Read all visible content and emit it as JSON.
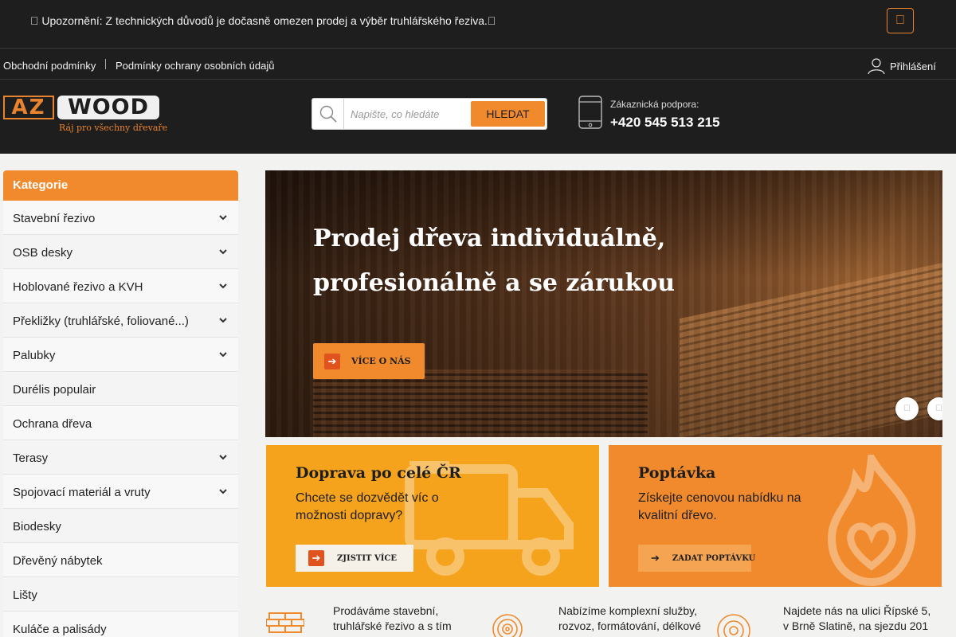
{
  "announcement": {
    "text": " Upozornění: Z technických důvodů je dočasně omezen prodej a výběr truhlářského řeziva.",
    "close_icon": ""
  },
  "top_links": {
    "terms": "Obchodní podmínky",
    "privacy": "Podmínky ochrany osobních údajů",
    "login": "Přihlášení"
  },
  "logo": {
    "az": "AZ",
    "wood": "WOOD",
    "tagline": "Ráj pro všechny dřevaře"
  },
  "search": {
    "placeholder": "Napište, co hledáte",
    "button": "HLEDAT"
  },
  "support": {
    "label": "Zákaznická podpora:",
    "phone": "+420 545 513 215"
  },
  "sidebar": {
    "title": "Kategorie",
    "items": [
      {
        "label": "Stavební řezivo",
        "has_sub": true
      },
      {
        "label": "OSB desky",
        "has_sub": true
      },
      {
        "label": "Hoblované řezivo a KVH",
        "has_sub": true
      },
      {
        "label": "Překližky (truhlářské, foliované...)",
        "has_sub": true
      },
      {
        "label": "Palubky",
        "has_sub": true
      },
      {
        "label": "Durélis populair",
        "has_sub": false
      },
      {
        "label": "Ochrana dřeva",
        "has_sub": false
      },
      {
        "label": "Terasy",
        "has_sub": true
      },
      {
        "label": "Spojovací materiál a vruty",
        "has_sub": true
      },
      {
        "label": "Biodesky",
        "has_sub": false
      },
      {
        "label": "Dřevěný nábytek",
        "has_sub": false
      },
      {
        "label": "Lišty",
        "has_sub": false
      },
      {
        "label": "Kuláče a palisády",
        "has_sub": false
      }
    ]
  },
  "hero": {
    "title_line1": "Prodej dřeva individuálně,",
    "title_line2": "profesionálně a se zárukou",
    "button": "VÍCE O NÁS",
    "prev_icon": "",
    "next_icon": ""
  },
  "promos": {
    "delivery": {
      "title": "Doprava po celé ČR",
      "desc": "Chcete se dozvědět víc o možnosti dopravy?",
      "button": "ZJISTIT VÍCE"
    },
    "inquiry": {
      "title": "Poptávka",
      "desc": "Získejte cenovou nabídku na kvalitní dřevo.",
      "button": "ZADAT POPTÁVKU"
    }
  },
  "features": [
    {
      "icon": "lumber-stack-icon",
      "text": "Prodáváme stavební, truhlářské řezivo a s tím"
    },
    {
      "icon": "wood-rings-icon",
      "text": "Nabízíme komplexní služby, rozvoz, formátování, délkové"
    },
    {
      "icon": "location-pin-icon",
      "text": "Najdete nás na ulici Řípské 5, v Brně Slatině, na sjezdu 201"
    }
  ],
  "colors": {
    "accent": "#f08a2d",
    "dark": "#1e1e1e",
    "promo_yellow": "#f5a21c"
  }
}
